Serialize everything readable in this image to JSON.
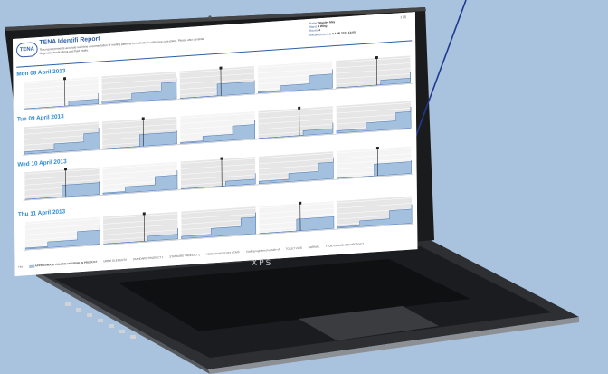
{
  "report": {
    "brand": "TENA",
    "title": "TENA Identifi Report",
    "subtitle": "This report presents accurate real-time documentation of voiding patterns for individual continence care plans. Please also consider diagnosis, medications and fluid intake.",
    "meta": [
      {
        "label": "Name:",
        "value": "Stanley May"
      },
      {
        "label": "Ward:",
        "value": "4 Wing"
      },
      {
        "label": "Room:",
        "value": "4"
      },
      {
        "label": "Recorded period:",
        "value": "6 APR 2013 13:00"
      }
    ],
    "page": "1 (3)",
    "ylabel": "Output",
    "days": [
      {
        "title": "Mon 08 April 2013"
      },
      {
        "title": "Tue 09 April 2013"
      },
      {
        "title": "Wed 10 April 2013"
      },
      {
        "title": "Thu 11 April 2013"
      }
    ],
    "footer": {
      "time_label": "Hrs",
      "items": [
        "APPROXIMATE VOLUME OF URINE IN PRODUCT",
        "URINE ELEMENTS",
        "STANDARD PRODUCT 1",
        "STANDARD PRODUCT 2",
        "VOID/CHANGED BY STAFF",
        "Voiding registered outside of",
        "TOILET VOID",
        "NORMAL",
        "FLUID INTAKE AND PRODUCT"
      ]
    }
  },
  "device": {
    "brand": "XPS"
  },
  "colors": {
    "accent": "#2e5ea7",
    "title": "#2e8ccf",
    "fill": "#a3c0df",
    "panel": "#e6e6e6",
    "background": "#a9c3df"
  }
}
